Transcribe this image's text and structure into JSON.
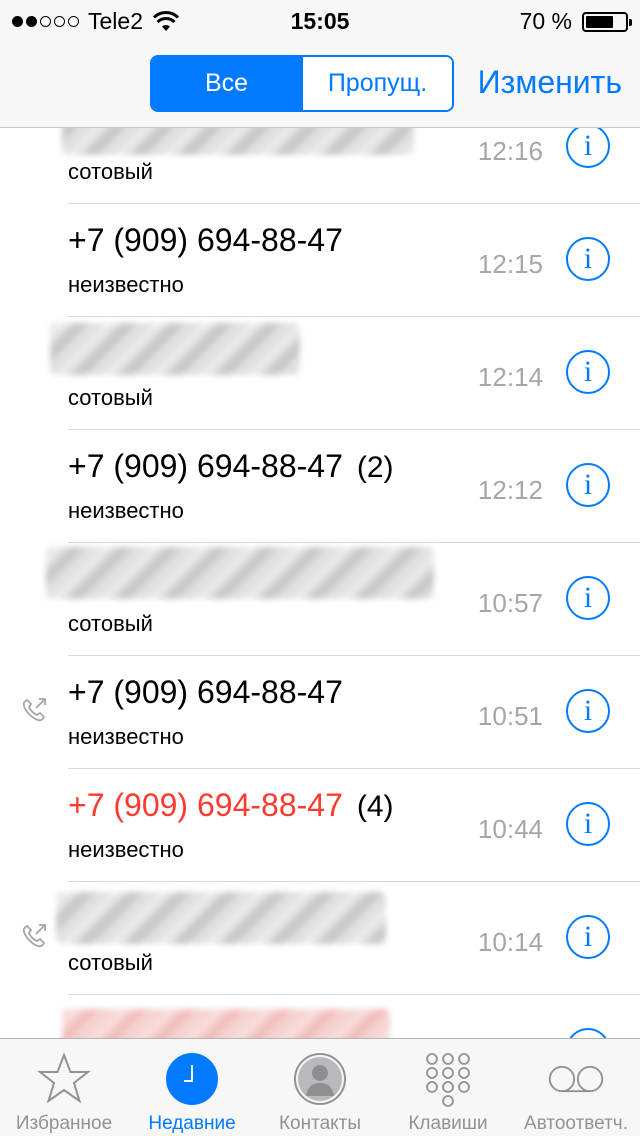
{
  "status_bar": {
    "carrier": "Tele2",
    "time": "15:05",
    "battery": "70 %",
    "battery_level": 0.7
  },
  "nav": {
    "segments": [
      "Все",
      "Пропущ."
    ],
    "active_segment": 0,
    "edit_label": "Изменить"
  },
  "calls": [
    {
      "name": "",
      "count": "",
      "type": "сотовый",
      "time": "12:16",
      "missed": false,
      "outgoing": false,
      "redacted": true
    },
    {
      "name": "+7 (909) 694-88-47",
      "count": "",
      "type": "неизвестно",
      "time": "12:15",
      "missed": false,
      "outgoing": false,
      "redacted": false
    },
    {
      "name": "",
      "count": "",
      "type": "сотовый",
      "time": "12:14",
      "missed": false,
      "outgoing": false,
      "redacted": true
    },
    {
      "name": "+7 (909) 694-88-47",
      "count": "(2)",
      "type": "неизвестно",
      "time": "12:12",
      "missed": false,
      "outgoing": false,
      "redacted": false
    },
    {
      "name": "",
      "count": "",
      "type": "сотовый",
      "time": "10:57",
      "missed": false,
      "outgoing": false,
      "redacted": true
    },
    {
      "name": "+7 (909) 694-88-47",
      "count": "",
      "type": "неизвестно",
      "time": "10:51",
      "missed": false,
      "outgoing": true,
      "redacted": false
    },
    {
      "name": "+7 (909) 694-88-47",
      "count": "(4)",
      "type": "неизвестно",
      "time": "10:44",
      "missed": true,
      "outgoing": false,
      "redacted": false
    },
    {
      "name": "",
      "count": "",
      "type": "сотовый",
      "time": "10:14",
      "missed": false,
      "outgoing": true,
      "redacted": true
    },
    {
      "name": "",
      "count": "",
      "type": "",
      "time": "",
      "missed": true,
      "outgoing": false,
      "redacted": true
    }
  ],
  "tabs": [
    {
      "label": "Избранное",
      "icon": "star-icon"
    },
    {
      "label": "Недавние",
      "icon": "clock-icon"
    },
    {
      "label": "Контакты",
      "icon": "contact-icon"
    },
    {
      "label": "Клавиши",
      "icon": "keypad-icon"
    },
    {
      "label": "Автоответч.",
      "icon": "voicemail-icon"
    }
  ],
  "active_tab": 1,
  "colors": {
    "accent": "#007aff",
    "missed": "#ff3b30",
    "time_gray": "#a5a5aa"
  }
}
